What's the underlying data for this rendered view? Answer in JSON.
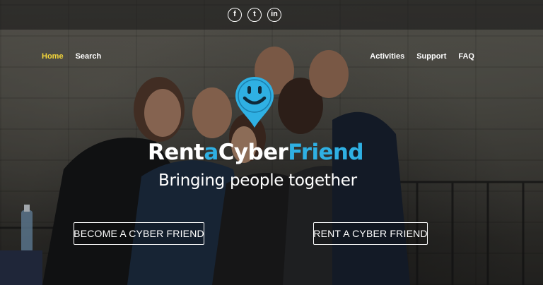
{
  "social": [
    {
      "icon": "facebook-icon",
      "glyph": "f"
    },
    {
      "icon": "twitter-icon",
      "glyph": "t"
    },
    {
      "icon": "linkedin-icon",
      "glyph": "in"
    }
  ],
  "nav": {
    "left": [
      {
        "label": "Home",
        "active": true
      },
      {
        "label": "Search",
        "active": false
      }
    ],
    "right": [
      {
        "label": "Activities"
      },
      {
        "label": "Support"
      },
      {
        "label": "FAQ"
      }
    ]
  },
  "brand": {
    "part1": "Rent",
    "part2": "a",
    "part3": "Cyber",
    "part4": "Friend"
  },
  "tagline": "Bringing people together",
  "cta": {
    "become_label": "BECOME A CYBER FRIEND",
    "rent_label": "RENT A CYBER FRIEND"
  },
  "colors": {
    "accent_blue": "#2fb0e3",
    "nav_active": "#f4d63a",
    "text": "#ffffff"
  }
}
